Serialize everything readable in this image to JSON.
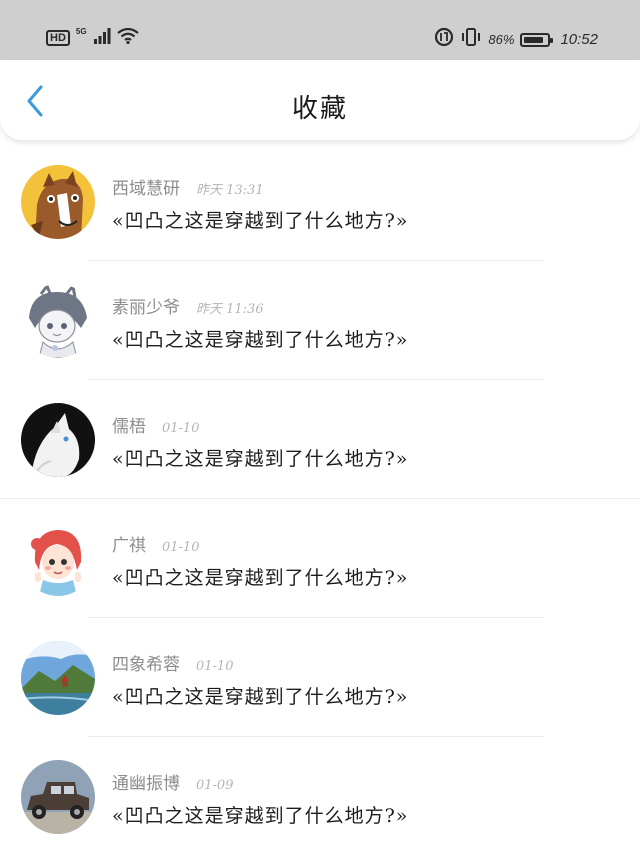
{
  "status_bar": {
    "hd_label": "HD",
    "network_label": "5G",
    "battery_percent": "86%",
    "battery_level": 0.86,
    "time": "10:52"
  },
  "nav": {
    "title": "收藏",
    "back_icon": "chevron-left-icon",
    "accent_color": "#3a9bdc"
  },
  "items": [
    {
      "author": "西域慧研",
      "time": "昨天 13:31",
      "title": "«凹凸之这是穿越到了什么地方?»",
      "avatar": "horse-cartoon"
    },
    {
      "author": "素丽少爷",
      "time": "昨天 11:36",
      "title": "«凹凸之这是穿越到了什么地方?»",
      "avatar": "sketch-cat-girl"
    },
    {
      "author": "儒梧",
      "time": "01-10",
      "title": "«凹凸之这是穿越到了什么地方?»",
      "avatar": "white-cat-dark"
    },
    {
      "author": "广祺",
      "time": "01-10",
      "title": "«凹凸之这是穿越到了什么地方?»",
      "avatar": "cartoon-girl"
    },
    {
      "author": "四象希蓉",
      "time": "01-10",
      "title": "«凹凸之这是穿越到了什么地方?»",
      "avatar": "landscape"
    },
    {
      "author": "通幽振博",
      "time": "01-09",
      "title": "«凹凸之这是穿越到了什么地方?»",
      "avatar": "vintage-car"
    }
  ]
}
